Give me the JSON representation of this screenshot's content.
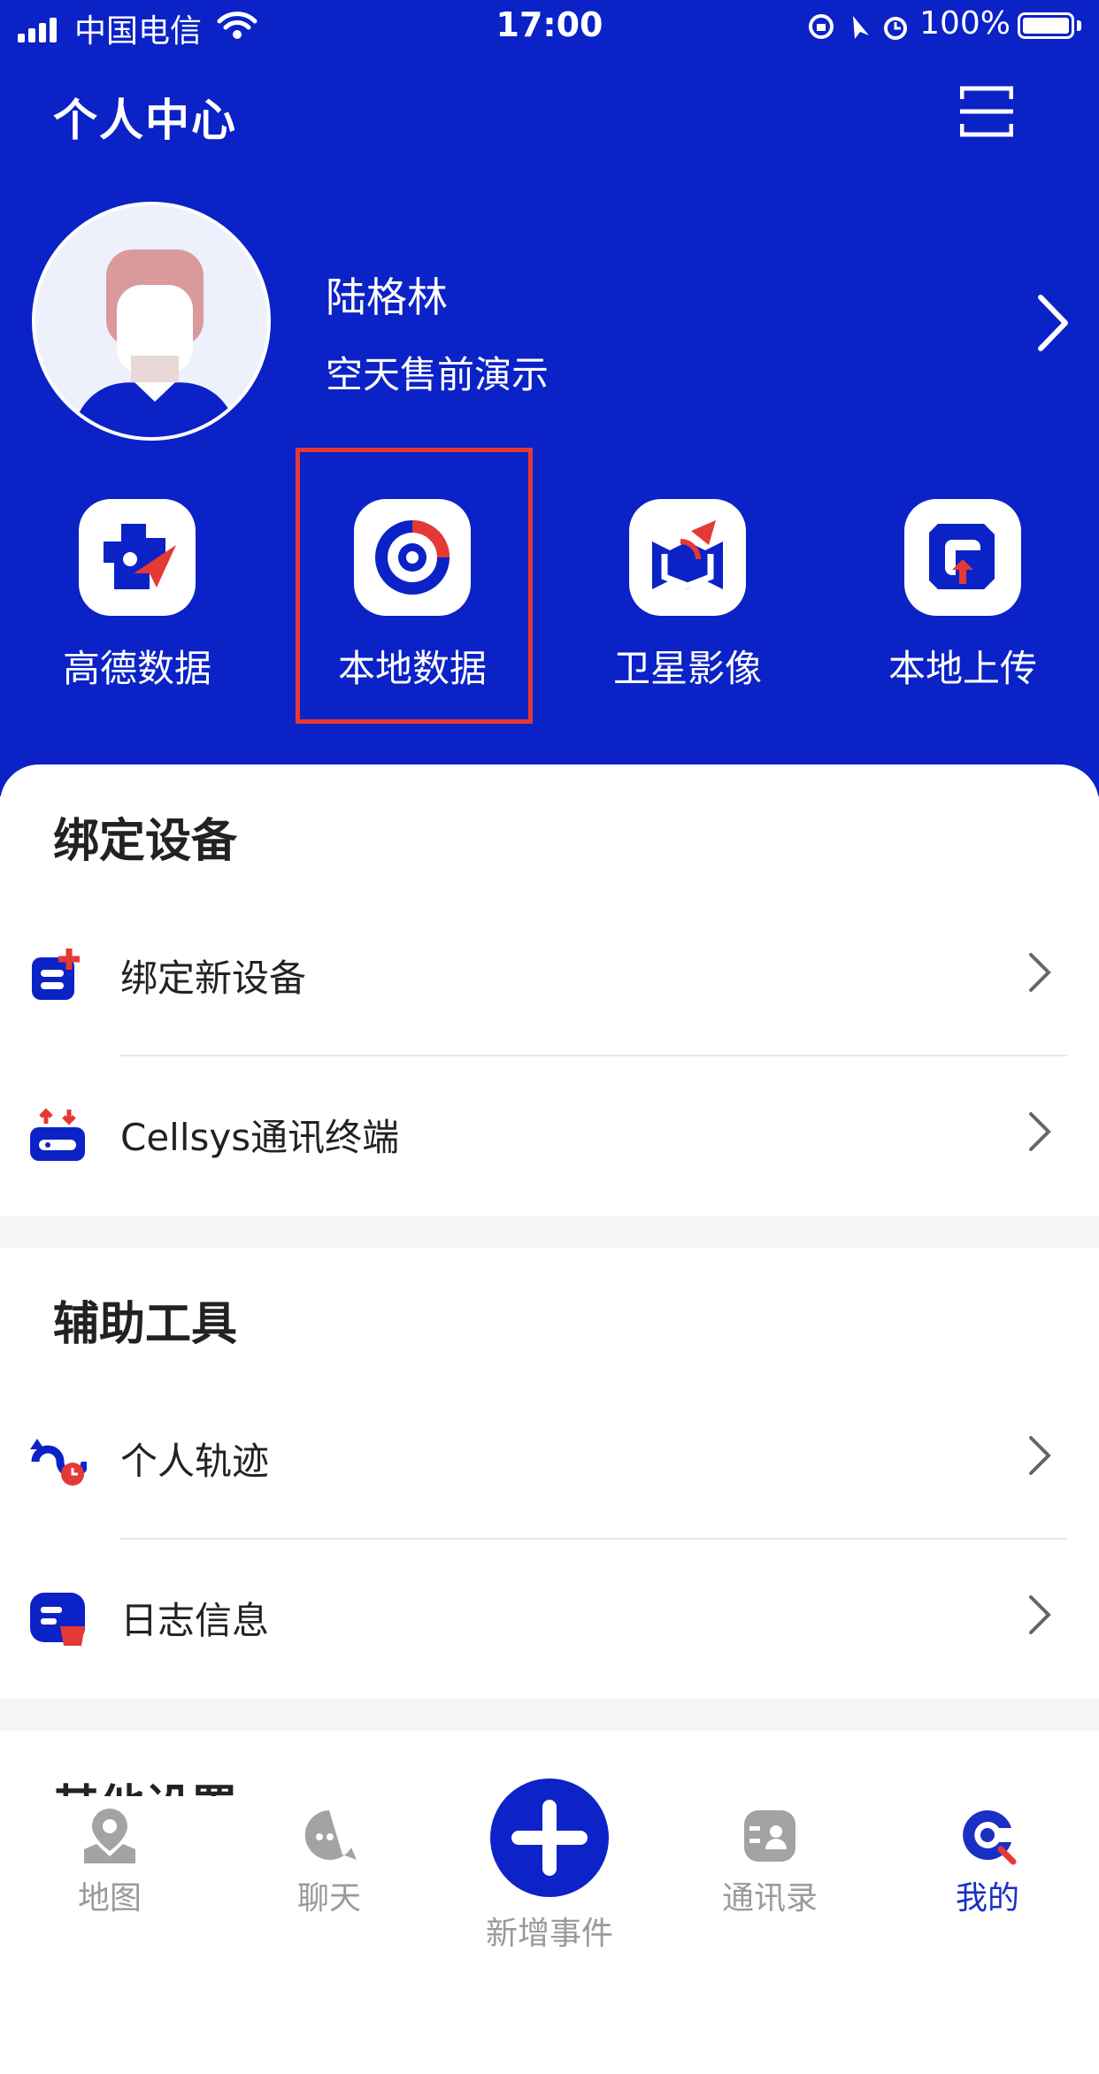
{
  "status_bar": {
    "carrier": "中国电信",
    "time": "17:00",
    "battery": "100%"
  },
  "header": {
    "title": "个人中心"
  },
  "profile": {
    "name": "陆格林",
    "organization": "空天售前演示"
  },
  "quick_actions": [
    {
      "label": "高德数据",
      "icon": "gaode-data-icon"
    },
    {
      "label": "本地数据",
      "icon": "local-data-icon"
    },
    {
      "label": "卫星影像",
      "icon": "satellite-image-icon"
    },
    {
      "label": "本地上传",
      "icon": "local-upload-icon"
    }
  ],
  "sections": [
    {
      "title": "绑定设备",
      "items": [
        {
          "label": "绑定新设备"
        },
        {
          "label": "Cellsys通讯终端"
        }
      ]
    },
    {
      "title": "辅助工具",
      "items": [
        {
          "label": "个人轨迹"
        },
        {
          "label": "日志信息"
        }
      ]
    },
    {
      "title": "其他设置",
      "items": []
    }
  ],
  "tabbar": {
    "tabs": [
      {
        "label": "地图",
        "icon": "map-pin-icon"
      },
      {
        "label": "聊天",
        "icon": "chat-icon"
      },
      {
        "label": "新增事件",
        "icon": "plus-icon"
      },
      {
        "label": "通讯录",
        "icon": "contacts-icon"
      },
      {
        "label": "我的",
        "icon": "profile-icon"
      }
    ],
    "active_index": 4
  },
  "colors": {
    "brand_blue": "#0b22c7",
    "accent_red": "#e53935",
    "highlight_border": "#e53935"
  }
}
